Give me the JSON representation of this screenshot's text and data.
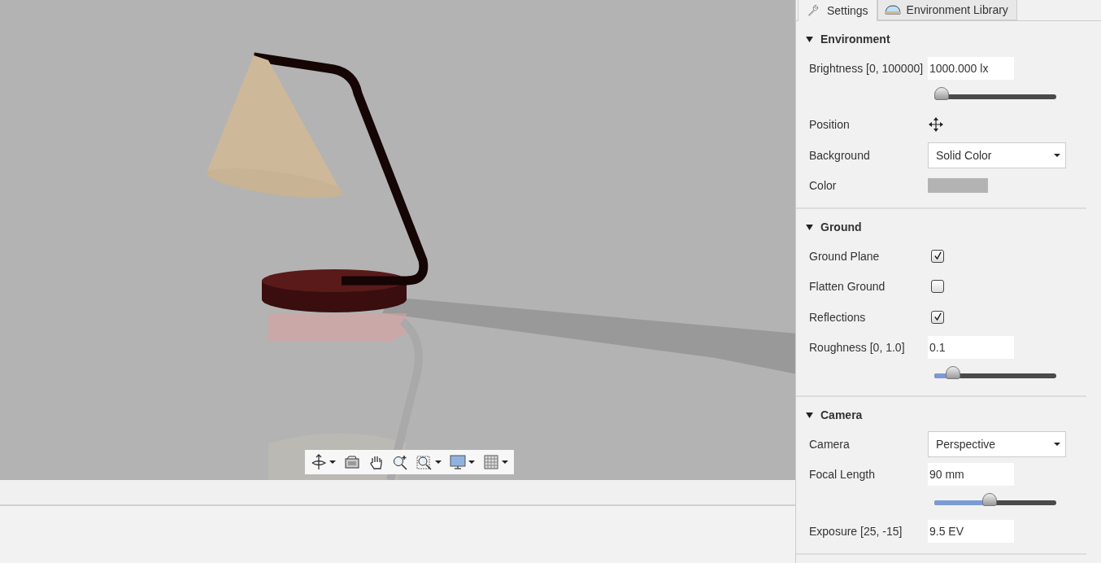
{
  "tabs": [
    {
      "label": "Settings",
      "selected": true
    },
    {
      "label": "Environment Library",
      "selected": false
    }
  ],
  "sections": [
    {
      "title": "Environment",
      "expanded": true,
      "rows": [
        {
          "kind": "field",
          "label": "Brightness [0, 100000]",
          "value": "1000.000 lx"
        },
        {
          "kind": "slider",
          "level": 0
        },
        {
          "kind": "move",
          "label": "Position"
        },
        {
          "kind": "select",
          "label": "Background",
          "value": "Solid Color"
        },
        {
          "kind": "color",
          "label": "Color",
          "color": "#b3b3b3"
        }
      ]
    },
    {
      "title": "Ground",
      "expanded": true,
      "rows": [
        {
          "kind": "checkbox",
          "label": "Ground Plane",
          "checked": true
        },
        {
          "kind": "checkbox",
          "label": "Flatten Ground",
          "checked": false
        },
        {
          "kind": "checkbox",
          "label": "Reflections",
          "checked": true
        },
        {
          "kind": "field",
          "label": "Roughness [0, 1.0]",
          "value": "0.1"
        },
        {
          "kind": "slider",
          "level": 0.1
        }
      ]
    },
    {
      "title": "Camera",
      "expanded": true,
      "rows": [
        {
          "kind": "select",
          "label": "Camera",
          "value": "Perspective"
        },
        {
          "kind": "field",
          "label": "Focal Length",
          "value": "90 mm"
        },
        {
          "kind": "slider",
          "level": 0.42
        },
        {
          "kind": "field",
          "label": "Exposure [25, -15]",
          "value": "9.5 EV"
        }
      ]
    }
  ]
}
